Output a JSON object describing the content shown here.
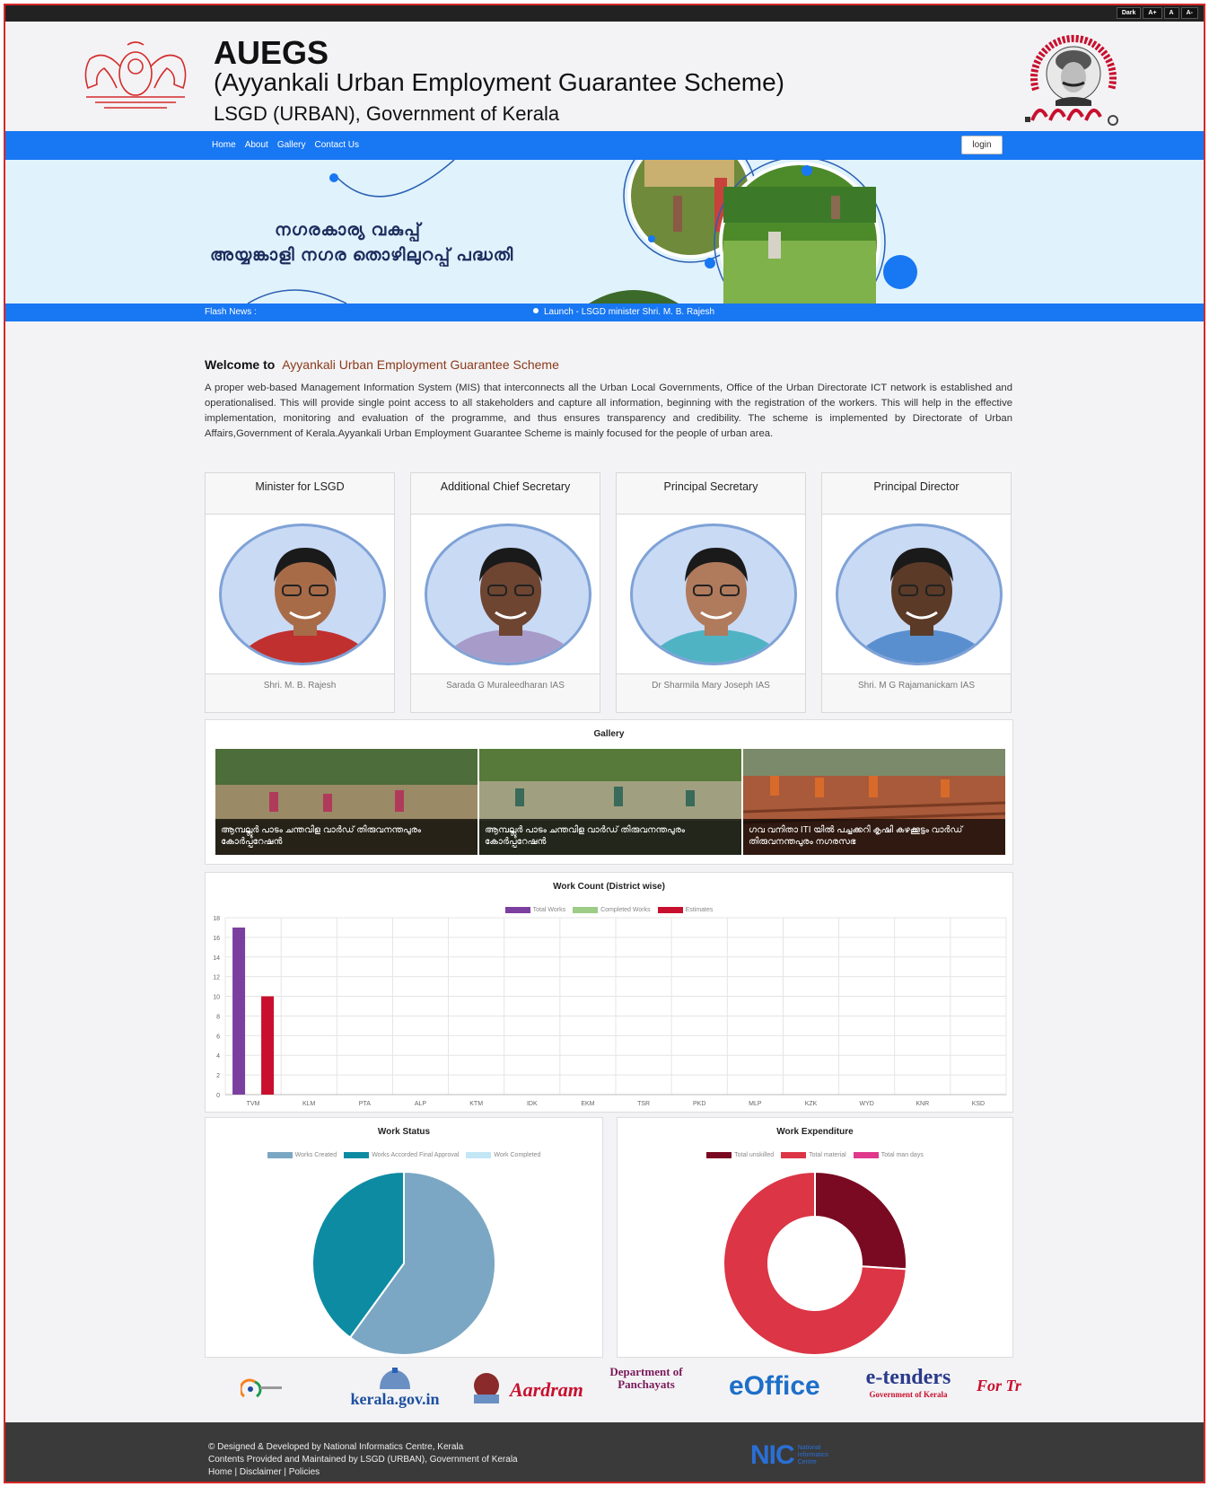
{
  "topbar": {
    "buttons": [
      "Dark",
      "A+",
      "A",
      "A-"
    ]
  },
  "header": {
    "title": "AUEGS",
    "subtitle": "(Ayyankali Urban Employment Guarantee Scheme)",
    "dept": "LSGD (URBAN), Government of Kerala"
  },
  "nav": {
    "items": [
      "Home",
      "About",
      "Gallery",
      "Contact Us"
    ],
    "login": "login"
  },
  "banner": {
    "line1": "നഗരകാര്യ വകുപ്പ്",
    "line2": "അയ്യങ്കാളി നഗര തൊഴിലുറപ്പ് പദ്ധതി"
  },
  "flash": {
    "label": "Flash News :",
    "item": "Launch - LSGD minister Shri. M. B. Rajesh"
  },
  "welcome": {
    "prefix": "Welcome to",
    "name": "Ayyankali Urban Employment Guarantee Scheme",
    "text": "A proper web-based Management Information System (MIS) that interconnects all the Urban Local Governments, Office of the Urban Directorate ICT network is established and operationalised. This will provide single point access to all stakeholders and capture all information, beginning with the registration of the workers. This will help in the effective implementation, monitoring and evaluation of the programme, and thus ensures transparency and credibility. The scheme is implemented by Directorate of Urban Affairs,Government of Kerala.Ayyankali Urban Employment Guarantee Scheme is mainly focused for the people of urban area."
  },
  "officers": [
    {
      "role": "Minister for LSGD",
      "name": "Shri. M. B. Rajesh",
      "shirt": "#c0302f",
      "skin": "#a86b48"
    },
    {
      "role": "Additional Chief Secretary",
      "name": "Sarada G Muraleedharan IAS",
      "shirt": "#a79bc9",
      "skin": "#6e4531"
    },
    {
      "role": "Principal Secretary",
      "name": "Dr Sharmila Mary Joseph IAS",
      "shirt": "#4fb3c4",
      "skin": "#b07a5c"
    },
    {
      "role": "Principal Director",
      "name": "Shri. M G Rajamanickam IAS",
      "shirt": "#5a8fcf",
      "skin": "#5b3a27"
    }
  ],
  "gallery": {
    "title": "Gallery",
    "items": [
      {
        "caption": "ആമ്പല്ലൂർ പാടം ചന്തവിള വാർഡ് തിരുവനന്തപുരം കോർപ്പറേഷൻ"
      },
      {
        "caption": "ആമ്പല്ലൂർ പാടം ചന്തവിള വാർഡ് തിരുവനന്തപുരം കോർപ്പറേഷൻ"
      },
      {
        "caption": "ഗവ വനിതാ ITI യിൽ പച്ചക്കറി കൃഷി കഴക്കൂട്ടം വാർഡ് തിരുവനന്തപുരം നഗരസഭ"
      }
    ]
  },
  "work_count": {
    "title": "Work Count (District wise)",
    "chart_data": {
      "type": "bar",
      "categories": [
        "TVM",
        "KLM",
        "PTA",
        "ALP",
        "KTM",
        "IDK",
        "EKM",
        "TSR",
        "PKD",
        "MLP",
        "KZK",
        "WYD",
        "KNR",
        "KSD"
      ],
      "series": [
        {
          "name": "Total Works",
          "color": "#7b3fa0",
          "values": [
            17,
            0,
            0,
            0,
            0,
            0,
            0,
            0,
            0,
            0,
            0,
            0,
            0,
            0
          ]
        },
        {
          "name": "Completed Works",
          "color": "#9ccc86",
          "values": [
            0,
            0,
            0,
            0,
            0,
            0,
            0,
            0,
            0,
            0,
            0,
            0,
            0,
            0
          ]
        },
        {
          "name": "Estimates",
          "color": "#c8102e",
          "values": [
            10,
            0,
            0,
            0,
            0,
            0,
            0,
            0,
            0,
            0,
            0,
            0,
            0,
            0
          ]
        }
      ],
      "yticks": [
        "0",
        "2",
        "4",
        "6",
        "8",
        "10",
        "12",
        "14",
        "16",
        "18"
      ],
      "ylim": [
        0,
        18
      ],
      "legend": "top"
    }
  },
  "work_status": {
    "title": "Work Status",
    "chart_data": {
      "type": "pie",
      "labels": [
        "Works Created",
        "Works Accorded Final Approval",
        "Work Completed"
      ],
      "colors": [
        "#7ba7c4",
        "#0d8ba3",
        "#c3e6f5"
      ],
      "values": [
        60,
        40,
        0
      ],
      "legend": "top"
    }
  },
  "work_expenditure": {
    "title": "Work Expenditure",
    "chart_data": {
      "type": "pie",
      "donut": true,
      "labels": [
        "Total unskilled",
        "Total material",
        "Total man days"
      ],
      "colors": [
        "#7a0a22",
        "#dc3545",
        "#e0388c"
      ],
      "values": [
        26,
        74,
        0
      ],
      "legend": "top"
    }
  },
  "partners": [
    "kerala.gov.in",
    "Aardram",
    "Department of Panchayats",
    "eOffice",
    "e-tenders",
    "Government of Kerala",
    "For Tr"
  ],
  "footer": {
    "line1": "© Designed & Developed by National Informatics Centre, Kerala",
    "line2": "Contents Provided and Maintained by LSGD (URBAN), Government of Kerala",
    "links": [
      "Home",
      "Disclaimer",
      "Policies"
    ],
    "nic": "NIC",
    "nic_sub": "National Informatics Centre"
  }
}
